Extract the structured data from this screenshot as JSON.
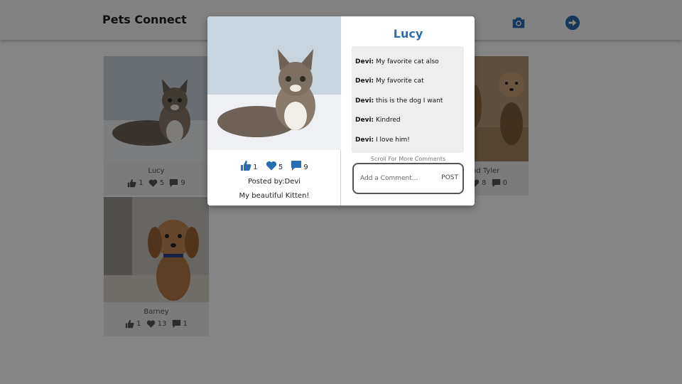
{
  "header": {
    "brand": "Pets Connect",
    "icons": [
      "camera-icon",
      "arrow-right-circle-icon"
    ]
  },
  "colors": {
    "accent": "#2a6db0",
    "overlay": "rgba(0,0,0,0.48)",
    "card_bg": "#ececec"
  },
  "gallery": [
    {
      "name": "Lucy",
      "likes": "1",
      "hearts": "5",
      "comments": "9"
    },
    {
      "name": "nd Tyler",
      "likes": "",
      "hearts": "8",
      "comments": "0"
    },
    {
      "name": "Barney",
      "likes": "1",
      "hearts": "13",
      "comments": "1"
    }
  ],
  "modal": {
    "title": "Lucy",
    "likes": "1",
    "hearts": "5",
    "comments_count": "9",
    "posted_by": "Posted by:Devi",
    "caption": "My beautiful Kitten!",
    "comments": [
      {
        "user": "Devi:",
        "text": "My favorite cat also"
      },
      {
        "user": "Devi:",
        "text": "My favorite cat"
      },
      {
        "user": "Devi:",
        "text": "this is the dog I want"
      },
      {
        "user": "Devi:",
        "text": "Kindred"
      },
      {
        "user": "Devi:",
        "text": "I love him!"
      }
    ],
    "scroll_hint": "Scroll For More Comments",
    "comment_placeholder": "Add a Comment...",
    "post_label": "POST"
  }
}
